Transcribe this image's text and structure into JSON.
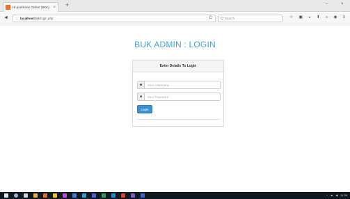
{
  "browser": {
    "tab_title": "Hr.pushkiran Online (BKK)",
    "tab_close": "×",
    "new_tab": "+",
    "minimize": "–",
    "close": "×",
    "back": "◄",
    "url_prefix": "localhost",
    "url_rest": "/bkk/login.php",
    "reload": "C",
    "search_placeholder": "Search",
    "search_glyph": "Q"
  },
  "page": {
    "title": "BUK ADMIN : LOGIN",
    "panel_title": "Enter Details To Login",
    "username_placeholder": "Your Username",
    "password_placeholder": "Your Password",
    "login_label": "Login"
  },
  "taskbar": {
    "time": "11:36",
    "tray_chevron": "^"
  },
  "colors": {
    "accent": "#4aa3d8",
    "button": "#3a8fd1"
  }
}
